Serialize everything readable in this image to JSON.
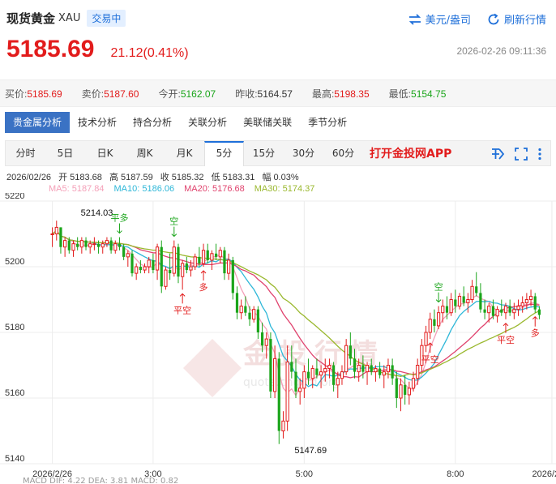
{
  "header": {
    "title": "现货黄金",
    "symbol": "XAU",
    "status_badge": "交易中",
    "currency_toggle": "美元/盎司",
    "refresh": "刷新行情",
    "last_price": "5185.69",
    "change": "21.12(0.41%)",
    "timestamp": "2026-02-26 09:11:36"
  },
  "quote": [
    {
      "label": "买价:",
      "value": "5185.69",
      "color": "red"
    },
    {
      "label": "卖价:",
      "value": "5187.60",
      "color": "red"
    },
    {
      "label": "今开:",
      "value": "5162.07",
      "color": "green"
    },
    {
      "label": "昨收:",
      "value": "5164.57",
      "color": "plain"
    },
    {
      "label": "最高:",
      "value": "5198.35",
      "color": "red"
    },
    {
      "label": "最低:",
      "value": "5154.75",
      "color": "green"
    }
  ],
  "category_tabs": [
    "贵金属分析",
    "技术分析",
    "持合分析",
    "关联分析",
    "美联储关联",
    "季节分析"
  ],
  "period_tabs": [
    "分时",
    "5日",
    "日K",
    "周K",
    "月K",
    "5分",
    "15分",
    "30分",
    "60分"
  ],
  "active_period": "5分",
  "app_link": "打开金投网APP",
  "info": {
    "date": "2026/02/26",
    "open_label": "开",
    "open": "5183.68",
    "high_label": "高",
    "high": "5187.59",
    "close_label": "收",
    "close": "5185.32",
    "low_label": "低",
    "low": "5183.31",
    "amp_label": "幅",
    "amp": "0.03%"
  },
  "ma_legend": [
    {
      "label": "MA5: 5187.84",
      "color": "#f4a0b8"
    },
    {
      "label": "MA10: 5186.06",
      "color": "#2eb7d8"
    },
    {
      "label": "MA20: 5176.68",
      "color": "#e0436e"
    },
    {
      "label": "MA30: 5174.37",
      "color": "#9ab82e"
    }
  ],
  "watermark": {
    "brand": "金投行情",
    "url": "quote.cngold.org"
  },
  "bottom_legend": "MACD  DIF: 4.22   DEA: 3.81   MACD: 0.82",
  "chart_data": {
    "type": "candlestick",
    "ylim": [
      5140,
      5220
    ],
    "yticks": [
      5140,
      5160,
      5180,
      5200,
      5220
    ],
    "xtick_labels": [
      {
        "i": 0,
        "label": "2026/2/26"
      },
      {
        "i": 24,
        "label": "3:00"
      },
      {
        "i": 60,
        "label": "5:00"
      },
      {
        "i": 96,
        "label": "8:00"
      },
      {
        "i": 119,
        "label": "2026/2/26"
      }
    ],
    "up_color": "#e21c1c",
    "down_color": "#1ba51b",
    "annotations": [
      {
        "i": 6,
        "price": 5214.03,
        "text": "5214.03",
        "kind": "high"
      },
      {
        "i": 60,
        "price": 5147.69,
        "text": "5147.69",
        "kind": "low"
      },
      {
        "i": 16,
        "text": "平多",
        "kind": "signal-top",
        "color": "#1ba51b"
      },
      {
        "i": 29,
        "text": "空",
        "kind": "signal-top",
        "color": "#1ba51b"
      },
      {
        "i": 31,
        "text": "平空",
        "kind": "signal-bottom",
        "color": "#e21c1c"
      },
      {
        "i": 36,
        "text": "多",
        "kind": "signal-bottom",
        "color": "#e21c1c"
      },
      {
        "i": 92,
        "text": "空",
        "kind": "signal-top",
        "color": "#1ba51b"
      },
      {
        "i": 90,
        "text": "平空",
        "kind": "signal-bottom",
        "color": "#e21c1c"
      },
      {
        "i": 108,
        "text": "平空",
        "kind": "signal-bottom",
        "color": "#e21c1c"
      },
      {
        "i": 115,
        "text": "多",
        "kind": "signal-bottom",
        "color": "#e21c1c"
      }
    ],
    "candles": [
      [
        5210,
        5212,
        5206,
        5210
      ],
      [
        5210,
        5214.03,
        5208,
        5212
      ],
      [
        5212,
        5212,
        5204,
        5206
      ],
      [
        5206,
        5209,
        5203,
        5208
      ],
      [
        5208,
        5209,
        5204,
        5205
      ],
      [
        5205,
        5208,
        5203,
        5207
      ],
      [
        5207,
        5209,
        5205,
        5206
      ],
      [
        5206,
        5209,
        5204,
        5208
      ],
      [
        5208,
        5209,
        5205,
        5206
      ],
      [
        5206,
        5208,
        5204,
        5207
      ],
      [
        5207,
        5209,
        5205,
        5207
      ],
      [
        5207,
        5208,
        5204,
        5206
      ],
      [
        5206,
        5208,
        5204,
        5207
      ],
      [
        5207,
        5209,
        5206,
        5208
      ],
      [
        5208,
        5209,
        5204,
        5205
      ],
      [
        5205,
        5208,
        5204,
        5207
      ],
      [
        5207,
        5209,
        5205,
        5206
      ],
      [
        5206,
        5207,
        5202,
        5203
      ],
      [
        5203,
        5205,
        5200,
        5204
      ],
      [
        5204,
        5205,
        5197,
        5198
      ],
      [
        5198,
        5201,
        5196,
        5200
      ],
      [
        5200,
        5202,
        5198,
        5199
      ],
      [
        5199,
        5201,
        5198,
        5200
      ],
      [
        5200,
        5203,
        5198,
        5202
      ],
      [
        5202,
        5204,
        5198,
        5199
      ],
      [
        5199,
        5207,
        5196,
        5206
      ],
      [
        5206,
        5208,
        5192,
        5194
      ],
      [
        5194,
        5200,
        5193,
        5199
      ],
      [
        5199,
        5204,
        5196,
        5198
      ],
      [
        5198,
        5208,
        5197,
        5206
      ],
      [
        5206,
        5207,
        5195,
        5197
      ],
      [
        5197,
        5202,
        5193,
        5201
      ],
      [
        5201,
        5203,
        5198,
        5199
      ],
      [
        5199,
        5202,
        5197,
        5200
      ],
      [
        5200,
        5204,
        5199,
        5203
      ],
      [
        5203,
        5206,
        5200,
        5201
      ],
      [
        5201,
        5207,
        5200,
        5205
      ],
      [
        5205,
        5207,
        5201,
        5202
      ],
      [
        5202,
        5205,
        5199,
        5204
      ],
      [
        5204,
        5207,
        5202,
        5203
      ],
      [
        5203,
        5206,
        5201,
        5205
      ],
      [
        5205,
        5206,
        5196,
        5198
      ],
      [
        5198,
        5204,
        5196,
        5202
      ],
      [
        5202,
        5203,
        5190,
        5192
      ],
      [
        5192,
        5194,
        5184,
        5186
      ],
      [
        5186,
        5190,
        5184,
        5188
      ],
      [
        5188,
        5191,
        5185,
        5186
      ],
      [
        5186,
        5188,
        5182,
        5184
      ],
      [
        5184,
        5188,
        5183,
        5187
      ],
      [
        5187,
        5188,
        5178,
        5180
      ],
      [
        5180,
        5183,
        5174,
        5176
      ],
      [
        5176,
        5180,
        5172,
        5178
      ],
      [
        5178,
        5180,
        5160,
        5162
      ],
      [
        5162,
        5176,
        5160,
        5172
      ],
      [
        5172,
        5174,
        5146,
        5150
      ],
      [
        5150,
        5156,
        5147.69,
        5153
      ],
      [
        5153,
        5176,
        5150,
        5171
      ],
      [
        5171,
        5176,
        5166,
        5168
      ],
      [
        5168,
        5172,
        5160,
        5162
      ],
      [
        5162,
        5166,
        5158,
        5163
      ],
      [
        5163,
        5170,
        5160,
        5168
      ],
      [
        5168,
        5172,
        5164,
        5166
      ],
      [
        5166,
        5170,
        5163,
        5169
      ],
      [
        5169,
        5172,
        5166,
        5167
      ],
      [
        5167,
        5170,
        5163,
        5168
      ],
      [
        5168,
        5172,
        5165,
        5169
      ],
      [
        5169,
        5172,
        5166,
        5170
      ],
      [
        5170,
        5171,
        5162,
        5164
      ],
      [
        5164,
        5168,
        5160,
        5166
      ],
      [
        5166,
        5170,
        5164,
        5168
      ],
      [
        5168,
        5178,
        5167,
        5176
      ],
      [
        5176,
        5180,
        5170,
        5172
      ],
      [
        5172,
        5175,
        5166,
        5168
      ],
      [
        5168,
        5172,
        5165,
        5170
      ],
      [
        5170,
        5173,
        5166,
        5168
      ],
      [
        5168,
        5171,
        5164,
        5170
      ],
      [
        5170,
        5172,
        5167,
        5168
      ],
      [
        5168,
        5170,
        5165,
        5169
      ],
      [
        5169,
        5171,
        5166,
        5167
      ],
      [
        5167,
        5170,
        5163,
        5168
      ],
      [
        5168,
        5172,
        5166,
        5170
      ],
      [
        5170,
        5172,
        5164,
        5166
      ],
      [
        5166,
        5168,
        5157,
        5160
      ],
      [
        5160,
        5166,
        5156,
        5164
      ],
      [
        5164,
        5167,
        5158,
        5161
      ],
      [
        5161,
        5165,
        5158,
        5163
      ],
      [
        5163,
        5168,
        5162,
        5166
      ],
      [
        5166,
        5172,
        5164,
        5170
      ],
      [
        5170,
        5178,
        5168,
        5176
      ],
      [
        5176,
        5182,
        5174,
        5180
      ],
      [
        5180,
        5186,
        5178,
        5184
      ],
      [
        5184,
        5187,
        5180,
        5182
      ],
      [
        5182,
        5188,
        5181,
        5186
      ],
      [
        5186,
        5190,
        5183,
        5188
      ],
      [
        5188,
        5191,
        5184,
        5186
      ],
      [
        5186,
        5192,
        5185,
        5190
      ],
      [
        5190,
        5193,
        5186,
        5188
      ],
      [
        5188,
        5192,
        5187,
        5191
      ],
      [
        5191,
        5194,
        5188,
        5189
      ],
      [
        5189,
        5192,
        5186,
        5190
      ],
      [
        5190,
        5196,
        5189,
        5194
      ],
      [
        5194,
        5198.35,
        5191,
        5192
      ],
      [
        5192,
        5195,
        5186,
        5187
      ],
      [
        5187,
        5190,
        5184,
        5186
      ],
      [
        5186,
        5189,
        5183,
        5188
      ],
      [
        5188,
        5190,
        5184,
        5185
      ],
      [
        5185,
        5188,
        5183,
        5187
      ],
      [
        5187,
        5190,
        5185,
        5186
      ],
      [
        5186,
        5189,
        5184,
        5188
      ],
      [
        5188,
        5190,
        5185,
        5186
      ],
      [
        5186,
        5189,
        5184,
        5187
      ],
      [
        5187,
        5190,
        5185,
        5188
      ],
      [
        5188,
        5191,
        5186,
        5189
      ],
      [
        5189,
        5192,
        5187,
        5190
      ],
      [
        5190,
        5193,
        5188,
        5191
      ],
      [
        5191,
        5192,
        5186,
        5187
      ],
      [
        5187,
        5188,
        5184,
        5185.32
      ]
    ]
  }
}
